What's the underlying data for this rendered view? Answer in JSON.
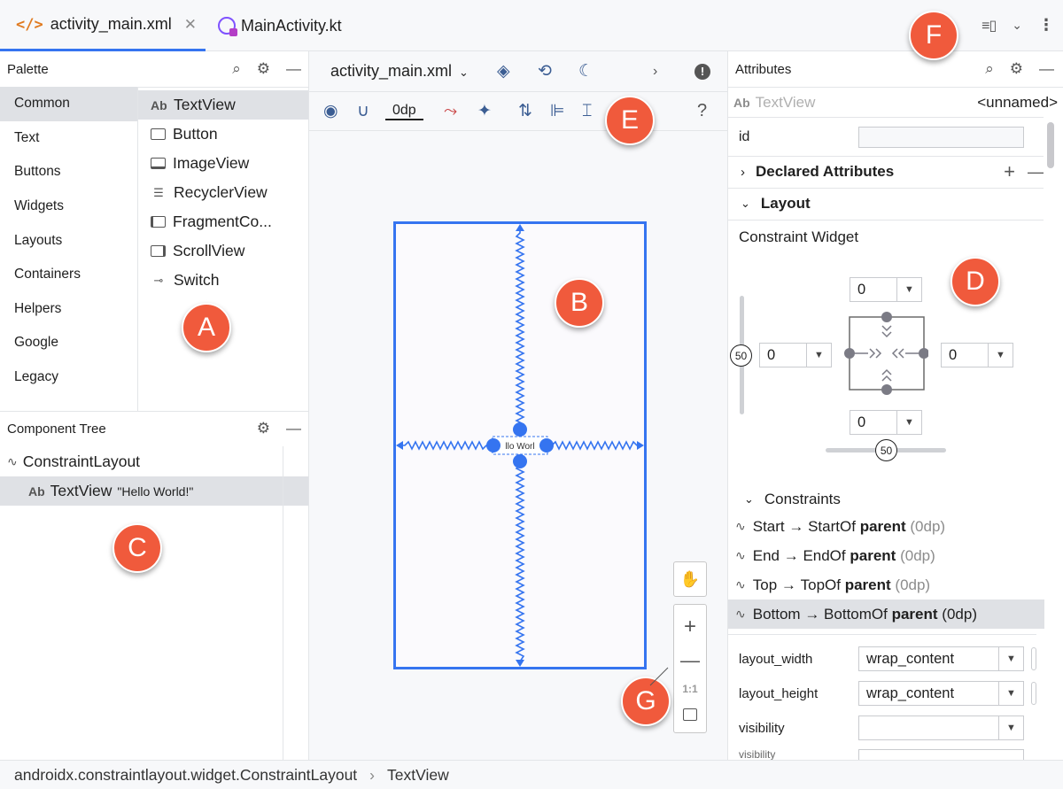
{
  "tabs": [
    {
      "label": "activity_main.xml",
      "active": true
    },
    {
      "label": "MainActivity.kt",
      "active": false
    }
  ],
  "palette": {
    "title": "Palette",
    "categories": [
      "Common",
      "Text",
      "Buttons",
      "Widgets",
      "Layouts",
      "Containers",
      "Helpers",
      "Google",
      "Legacy"
    ],
    "selected_category": "Common",
    "widgets": [
      {
        "icon": "Ab",
        "label": "TextView"
      },
      {
        "icon": "button-icon",
        "label": "Button"
      },
      {
        "icon": "image-icon",
        "label": "ImageView"
      },
      {
        "icon": "list-icon",
        "label": "RecyclerView"
      },
      {
        "icon": "fragment-icon",
        "label": "FragmentCo..."
      },
      {
        "icon": "scroll-icon",
        "label": "ScrollView"
      },
      {
        "icon": "switch-icon",
        "label": "Switch"
      }
    ]
  },
  "component_tree": {
    "title": "Component Tree",
    "root": "ConstraintLayout",
    "child_icon": "Ab",
    "child": "TextView",
    "child_text": "\"Hello World!\""
  },
  "design": {
    "file_selector": "activity_main.xml",
    "margin_value": "0dp",
    "help": "?",
    "preview_text": "llo Worl",
    "zoom_ratio": "1:1"
  },
  "attributes": {
    "title": "Attributes",
    "widget_prefix": "Ab",
    "widget_type": "TextView",
    "widget_name": "<unnamed>",
    "id_label": "id",
    "id_value": "",
    "declared_attributes": "Declared Attributes",
    "layout_section": "Layout",
    "constraint_widget": "Constraint Widget",
    "margins": {
      "top": "0",
      "left": "0",
      "right": "0",
      "bottom": "0"
    },
    "vertical_bias": "50",
    "horizontal_bias": "50",
    "constraints_title": "Constraints",
    "constraints": [
      {
        "side": "Start",
        "target": "StartOf",
        "parent": "parent",
        "value": "(0dp)"
      },
      {
        "side": "End",
        "target": "EndOf",
        "parent": "parent",
        "value": "(0dp)"
      },
      {
        "side": "Top",
        "target": "TopOf",
        "parent": "parent",
        "value": "(0dp)"
      },
      {
        "side": "Bottom",
        "target": "BottomOf",
        "parent": "parent",
        "value": "(0dp)"
      }
    ],
    "props": [
      {
        "label": "layout_width",
        "value": "wrap_content"
      },
      {
        "label": "layout_height",
        "value": "wrap_content"
      },
      {
        "label": "visibility",
        "value": ""
      },
      {
        "label": "visibility",
        "value": ""
      }
    ]
  },
  "breadcrumb": {
    "parent": "androidx.constraintlayout.widget.ConstraintLayout",
    "separator": "›",
    "child": "TextView"
  },
  "callouts": [
    "A",
    "B",
    "C",
    "D",
    "E",
    "F",
    "G"
  ],
  "colors": {
    "accent": "#3574f0",
    "callout": "#f05a3c",
    "selection": "#dfe1e5",
    "xml_icon": "#e07a1f"
  }
}
